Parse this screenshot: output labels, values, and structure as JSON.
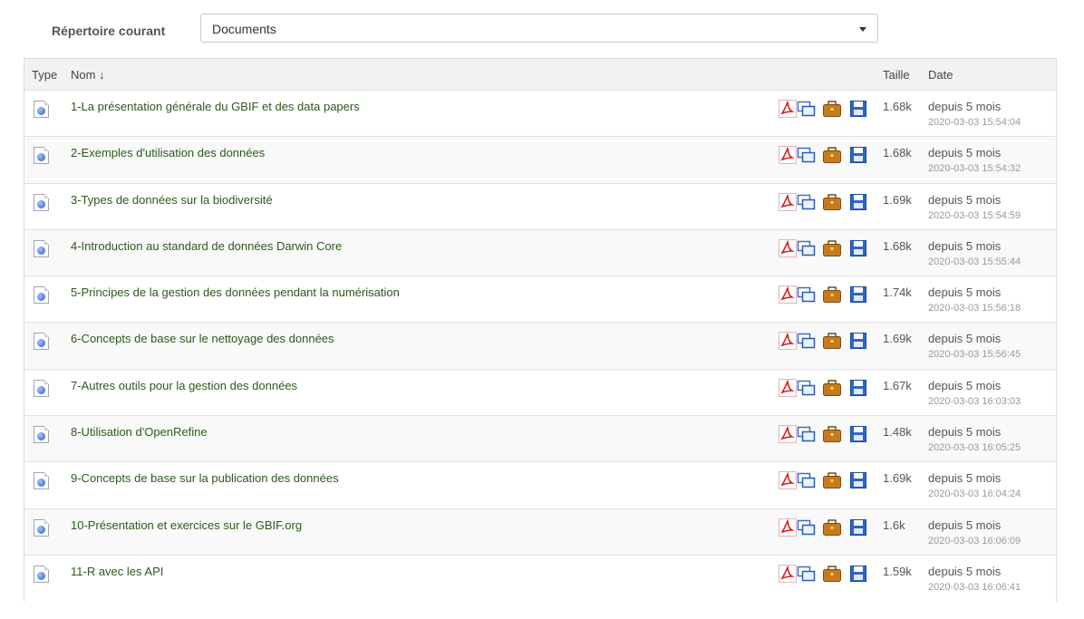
{
  "directory": {
    "label": "Répertoire courant",
    "selected": "Documents"
  },
  "table": {
    "headers": {
      "type": "Type",
      "name": "Nom ↓",
      "size": "Taille",
      "date": "Date"
    },
    "rows": [
      {
        "name": "1-La présentation générale du GBIF et des data papers",
        "size": "1.68k",
        "relative": "depuis 5 mois",
        "timestamp": "2020-03-03 15:54:04"
      },
      {
        "name": "2-Exemples d'utilisation des données",
        "size": "1.68k",
        "relative": "depuis 5 mois",
        "timestamp": "2020-03-03 15:54:32"
      },
      {
        "name": "3-Types de données sur la biodiversité",
        "size": "1.69k",
        "relative": "depuis 5 mois",
        "timestamp": "2020-03-03 15:54:59"
      },
      {
        "name": "4-Introduction au standard de données Darwin Core",
        "size": "1.68k",
        "relative": "depuis 5 mois",
        "timestamp": "2020-03-03 15:55:44"
      },
      {
        "name": "5-Principes de la gestion des données pendant la numérisation",
        "size": "1.74k",
        "relative": "depuis 5 mois",
        "timestamp": "2020-03-03 15:56:18"
      },
      {
        "name": "6-Concepts de base sur le nettoyage des données",
        "size": "1.69k",
        "relative": "depuis 5 mois",
        "timestamp": "2020-03-03 15:56:45"
      },
      {
        "name": "7-Autres outils pour la gestion des données",
        "size": "1.67k",
        "relative": "depuis 5 mois",
        "timestamp": "2020-03-03 16:03:03"
      },
      {
        "name": "8-Utilisation d'OpenRefine",
        "size": "1.48k",
        "relative": "depuis 5 mois",
        "timestamp": "2020-03-03 16:05:25"
      },
      {
        "name": "9-Concepts de base sur la publication des données",
        "size": "1.69k",
        "relative": "depuis 5 mois",
        "timestamp": "2020-03-03 16:04:24"
      },
      {
        "name": "10-Présentation et exercices sur le GBIF.org",
        "size": "1.6k",
        "relative": "depuis 5 mois",
        "timestamp": "2020-03-03 16:06:09"
      },
      {
        "name": "11-R avec les API",
        "size": "1.59k",
        "relative": "depuis 5 mois",
        "timestamp": "2020-03-03 16:06:41"
      }
    ]
  },
  "icons": {
    "type": "html-document-icon",
    "actions": [
      "pdf-icon",
      "copy-icon",
      "briefcase-icon",
      "save-icon"
    ]
  },
  "colors": {
    "link": "#2b5a1c",
    "header_bg": "#f2f2f2",
    "stripe": "#f9f9f9"
  }
}
